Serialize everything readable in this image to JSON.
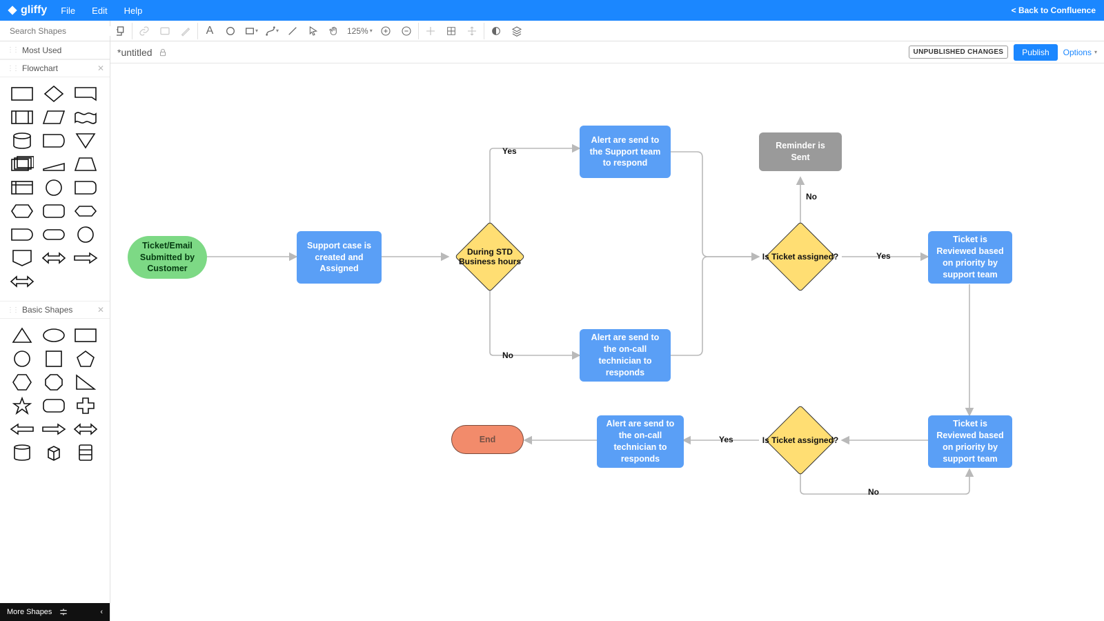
{
  "app": {
    "name": "gliffy"
  },
  "menubar": {
    "items": [
      "File",
      "Edit",
      "Help"
    ],
    "back": "< Back to Confluence"
  },
  "toolbar": {
    "zoom": "125%"
  },
  "doc": {
    "title": "*untitled",
    "unpublished": "UNPUBLISHED CHANGES",
    "publish": "Publish",
    "options": "Options"
  },
  "sidebar": {
    "search_placeholder": "Search Shapes",
    "sections": {
      "most_used": "Most Used",
      "flowchart": "Flowchart",
      "basic": "Basic Shapes"
    },
    "more": "More Shapes"
  },
  "flow": {
    "n1": "Ticket/Email Submitted by Customer",
    "n2": "Support case is created and Assigned",
    "d1": "During STD Business hours",
    "n3": "Alert are send to the Support team to respond",
    "n4": "Alert are send to the on-call technician to responds",
    "d2": "Is Ticket assigned?",
    "n5": "Reminder is Sent",
    "n6": "Ticket is Reviewed based on priority by support team",
    "n7": "Ticket is Reviewed based on priority by support team",
    "d3": "Is Ticket assigned?",
    "n8": "Alert are send to the on-call technician to responds",
    "end": "End",
    "yes": "Yes",
    "no": "No"
  }
}
